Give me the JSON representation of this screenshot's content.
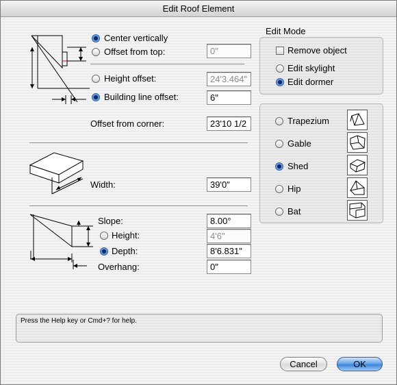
{
  "window": {
    "title": "Edit Roof Element"
  },
  "position": {
    "center_vertically": "Center vertically",
    "offset_from_top": "Offset from top:",
    "offset_from_top_value": "0\"",
    "height_offset": "Height offset:",
    "height_offset_value": "24'3.464\"",
    "building_line_offset": "Building line offset:",
    "building_line_offset_value": "6\"",
    "offset_from_corner": "Offset from corner:",
    "offset_from_corner_value": "23'10 1/2"
  },
  "size": {
    "width_label": "Width:",
    "width_value": "39'0\""
  },
  "slope": {
    "slope_label": "Slope:",
    "slope_value": "8.00°",
    "height_label": "Height:",
    "height_value": "4'6\"",
    "depth_label": "Depth:",
    "depth_value": "8'6.831\"",
    "overhang_label": "Overhang:",
    "overhang_value": "0\""
  },
  "edit_mode": {
    "title": "Edit Mode",
    "remove_object": "Remove object",
    "edit_skylight": "Edit skylight",
    "edit_dormer": "Edit dormer"
  },
  "dormer_types": [
    {
      "label": "Trapezium",
      "icon": "trapezium-dormer-icon",
      "selected": false
    },
    {
      "label": "Gable",
      "icon": "gable-dormer-icon",
      "selected": false
    },
    {
      "label": "Shed",
      "icon": "shed-dormer-icon",
      "selected": true
    },
    {
      "label": "Hip",
      "icon": "hip-dormer-icon",
      "selected": false
    },
    {
      "label": "Bat",
      "icon": "bat-dormer-icon",
      "selected": false
    }
  ],
  "help_text": "Press the Help key or Cmd+? for help.",
  "buttons": {
    "cancel": "Cancel",
    "ok": "OK"
  }
}
